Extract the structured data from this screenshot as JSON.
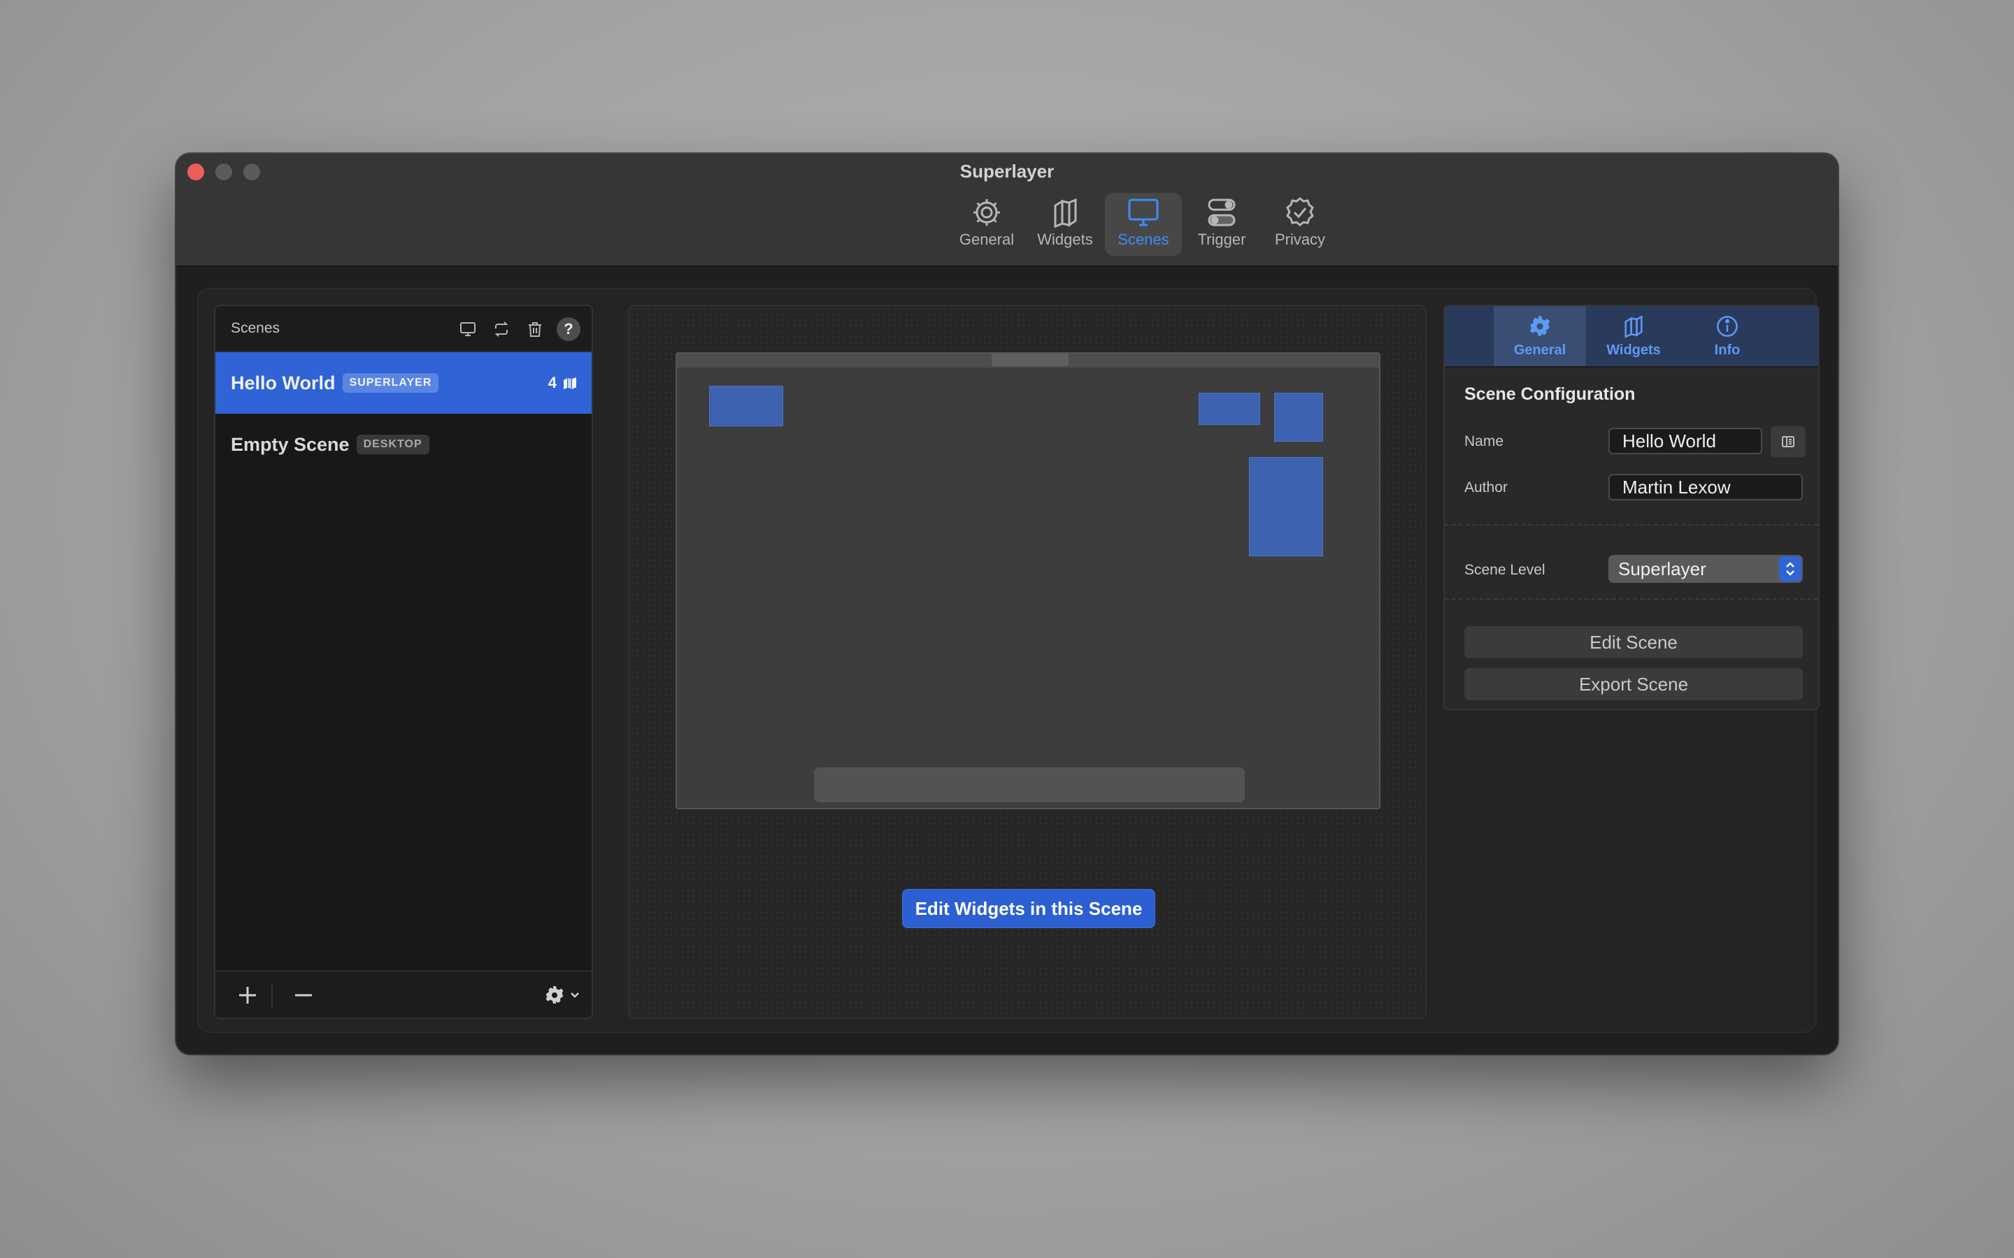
{
  "window": {
    "title": "Superlayer"
  },
  "toolbar": {
    "items": [
      {
        "label": "General",
        "icon": "gear-icon"
      },
      {
        "label": "Widgets",
        "icon": "widgets-icon"
      },
      {
        "label": "Scenes",
        "icon": "display-icon",
        "active": true
      },
      {
        "label": "Trigger",
        "icon": "toggles-icon"
      },
      {
        "label": "Privacy",
        "icon": "checkmark-seal-icon"
      }
    ]
  },
  "sidebar": {
    "title": "Scenes",
    "help": "?",
    "scenes": [
      {
        "name": "Hello World",
        "level": "SUPERLAYER",
        "widget_count": "4",
        "selected": true
      },
      {
        "name": "Empty Scene",
        "level": "DESKTOP",
        "selected": false
      }
    ]
  },
  "preview": {
    "edit_button": "Edit Widgets in this Scene"
  },
  "inspector": {
    "tabs": [
      {
        "label": "General",
        "active": true
      },
      {
        "label": "Widgets"
      },
      {
        "label": "Info"
      }
    ],
    "section_title": "Scene Configuration",
    "name_label": "Name",
    "name_value": "Hello World",
    "author_label": "Author",
    "author_value": "Martin Lexow",
    "level_label": "Scene Level",
    "level_value": "Superlayer",
    "edit_scene": "Edit Scene",
    "export_scene": "Export Scene"
  },
  "colors": {
    "accent": "#2f63d6",
    "link": "#3f8cf6",
    "close": "#ec5f58"
  }
}
